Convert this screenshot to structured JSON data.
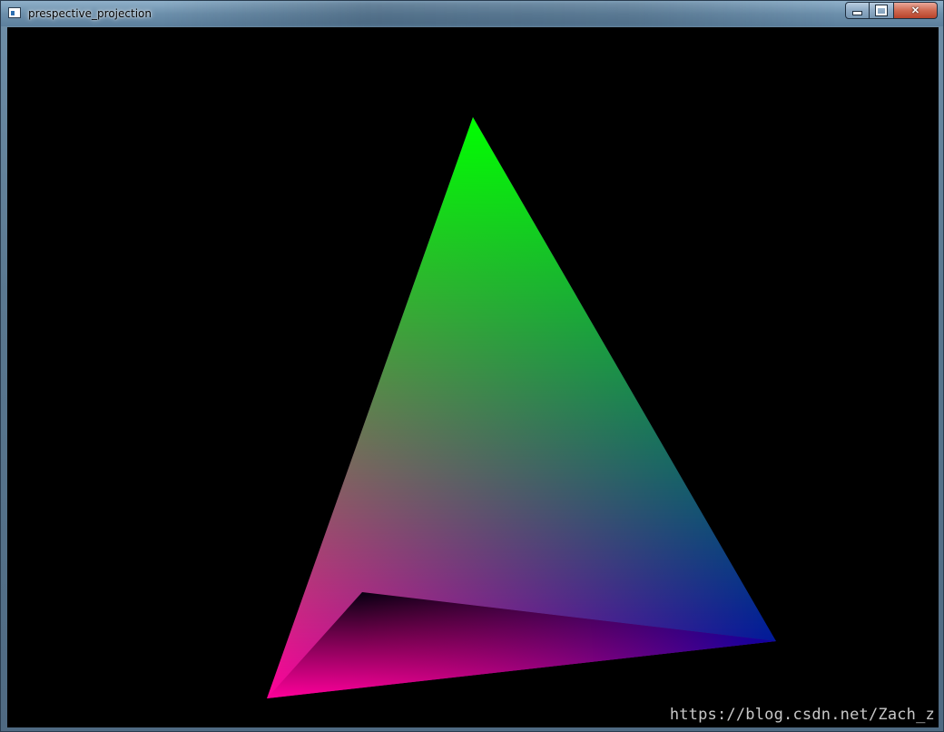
{
  "window": {
    "title": "prespective_projection",
    "controls": {
      "minimize": "minimize",
      "maximize": "maximize",
      "close": "✕"
    }
  },
  "canvas": {
    "background": "#000000",
    "watermark": "https://blog.csdn.net/Zach_z"
  },
  "colors": {
    "apex": "#00ff00",
    "left_vertex": "#ff0099",
    "right_vertex": "#0000aa",
    "inner_vertex": "#000022"
  }
}
